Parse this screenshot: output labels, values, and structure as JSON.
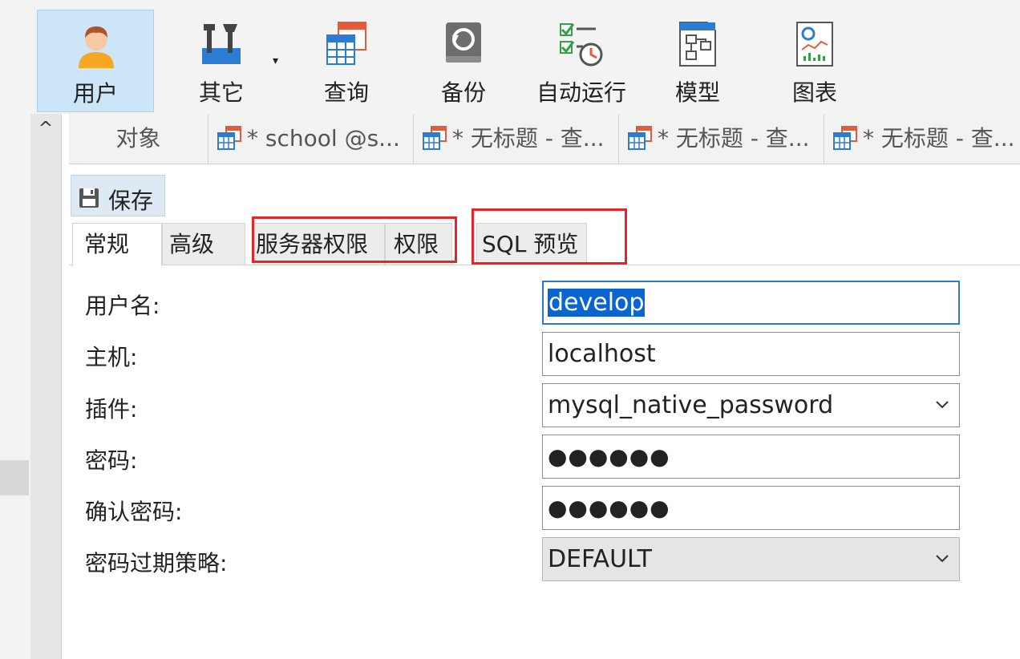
{
  "toolbar": {
    "items": [
      {
        "id": "user",
        "label": "用户",
        "icon": "user-icon"
      },
      {
        "id": "other",
        "label": "其它",
        "icon": "tools-icon"
      },
      {
        "id": "query",
        "label": "查询",
        "icon": "query-table-icon"
      },
      {
        "id": "backup",
        "label": "备份",
        "icon": "backup-icon"
      },
      {
        "id": "auto_run",
        "label": "自动运行",
        "icon": "checklist-clock-icon"
      },
      {
        "id": "model",
        "label": "模型",
        "icon": "model-icon"
      },
      {
        "id": "chart",
        "label": "图表",
        "icon": "chart-icon"
      }
    ],
    "dropdown_arrow": "▾"
  },
  "sidebar": {
    "scroll_up": "^"
  },
  "doc_tabs": {
    "objects": "对象",
    "tabs": [
      {
        "label": "* school @s...",
        "icon": "table-icon"
      },
      {
        "label": "* 无标题 - 查...",
        "icon": "table-icon"
      },
      {
        "label": "* 无标题 - 查...",
        "icon": "table-icon"
      },
      {
        "label": "* 无标题 - 查...",
        "icon": "table-icon"
      }
    ]
  },
  "save": {
    "label": "保存",
    "icon": "save-icon"
  },
  "prop_tabs": {
    "general": "常规",
    "advanced": "高级",
    "server_privileges": "服务器权限",
    "privileges": "权限",
    "sql_preview": "SQL 预览"
  },
  "form": {
    "username": {
      "label": "用户名:",
      "value": "develop"
    },
    "host": {
      "label": "主机:",
      "value": "localhost"
    },
    "plugin": {
      "label": "插件:",
      "value": "mysql_native_password"
    },
    "password": {
      "label": "密码:",
      "value": "●●●●●●"
    },
    "confirm_password": {
      "label": "确认密码:",
      "value": "●●●●●●"
    },
    "password_expiry": {
      "label": "密码过期策略:",
      "value": "DEFAULT"
    }
  },
  "colors": {
    "accent": "#0a64d2",
    "selected_toolbar": "#cde6f7",
    "highlight_box": "#e4262a"
  }
}
